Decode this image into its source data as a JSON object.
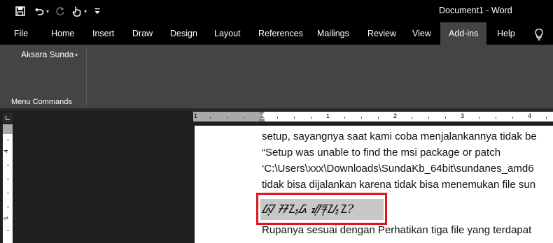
{
  "window": {
    "title": "Document1  -  Word"
  },
  "qat": {
    "icons": [
      "save-icon",
      "undo-icon",
      "redo-icon",
      "touch-mode-icon",
      "customize-qat-icon"
    ]
  },
  "tabs": [
    {
      "label": "File",
      "active": false
    },
    {
      "label": "Home",
      "active": false
    },
    {
      "label": "Insert",
      "active": false
    },
    {
      "label": "Draw",
      "active": false
    },
    {
      "label": "Design",
      "active": false
    },
    {
      "label": "Layout",
      "active": false
    },
    {
      "label": "References",
      "active": false
    },
    {
      "label": "Mailings",
      "active": false
    },
    {
      "label": "Review",
      "active": false
    },
    {
      "label": "View",
      "active": false
    },
    {
      "label": "Add-ins",
      "active": true
    },
    {
      "label": "Help",
      "active": false
    }
  ],
  "ribbon": {
    "menu_button": "Aksara Sunda",
    "group_label": "Menu Commands"
  },
  "ruler": {
    "horizontal_numbers": [
      "1",
      "1",
      "2",
      "3",
      "4"
    ],
    "vertical_numbers": [
      "4",
      "5"
    ]
  },
  "document": {
    "lines": [
      "setup, sayangnya saat kami coba menjalankannya tidak be",
      "“Setup was unable to find the msi package or patch",
      "‘C:\\Users\\xxx\\Downloads\\SundaKb_64bit\\sundanes_amd6",
      "tidak bisa dijalankan karena tidak bisa menemukan file sun"
    ],
    "highlighted_text": "ᮘᮥ ᮞᮔ᮪ᮓ ᮠᮥᮛᮥᮖ᮪ᮔ?",
    "line_after": "Rupanya sesuai dengan Perhatikan tiga file yang terdapat"
  },
  "colors": {
    "titlebar": "#000000",
    "ribbon": "#444444",
    "active_tab": "#444444",
    "highlight_box": "#e0141b",
    "text_highlight": "#c8c8c8"
  }
}
